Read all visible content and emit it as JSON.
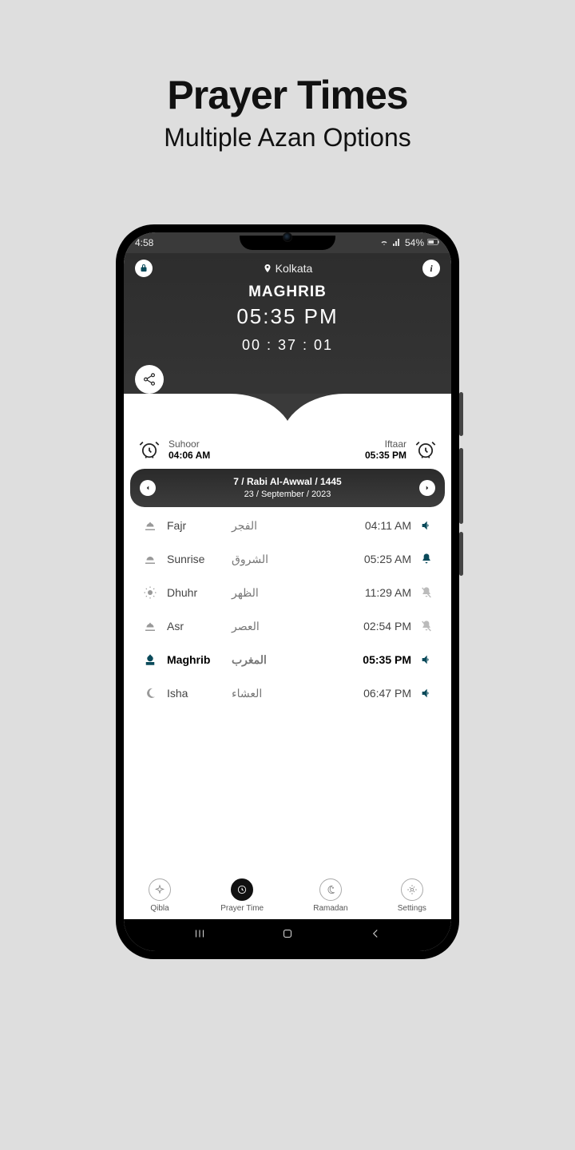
{
  "promo": {
    "title": "Prayer Times",
    "subtitle": "Multiple Azan Options"
  },
  "statusbar": {
    "time": "4:58",
    "battery": "54%"
  },
  "header": {
    "location": "Kolkata",
    "current_prayer": "MAGHRIB",
    "current_time": "05:35 PM",
    "countdown": "00 : 37 : 01"
  },
  "ramadan": {
    "suhoor_label": "Suhoor",
    "suhoor_time": "04:06 AM",
    "iftaar_label": "Iftaar",
    "iftaar_time": "05:35 PM"
  },
  "date": {
    "hijri": "7 / Rabi Al-Awwal / 1445",
    "gregorian": "23 / September / 2023"
  },
  "prayers": [
    {
      "name": "Fajr",
      "arabic": "الفجر",
      "time": "04:11 AM",
      "alert": "sound",
      "icon": "dawn",
      "current": false
    },
    {
      "name": "Sunrise",
      "arabic": "الشروق",
      "time": "05:25 AM",
      "alert": "bell",
      "icon": "sunrise",
      "current": false
    },
    {
      "name": "Dhuhr",
      "arabic": "الظهر",
      "time": "11:29 AM",
      "alert": "muted",
      "icon": "sun",
      "current": false
    },
    {
      "name": "Asr",
      "arabic": "العصر",
      "time": "02:54 PM",
      "alert": "muted",
      "icon": "dawn",
      "current": false
    },
    {
      "name": "Maghrib",
      "arabic": "المغرب",
      "time": "05:35 PM",
      "alert": "sound",
      "icon": "mosque",
      "current": true
    },
    {
      "name": "Isha",
      "arabic": "العشاء",
      "time": "06:47 PM",
      "alert": "sound",
      "icon": "moon",
      "current": false
    }
  ],
  "nav": {
    "qibla": "Qibla",
    "prayer_time": "Prayer Time",
    "ramadan": "Ramadan",
    "settings": "Settings"
  },
  "colors": {
    "accent": "#0a4a5a"
  }
}
